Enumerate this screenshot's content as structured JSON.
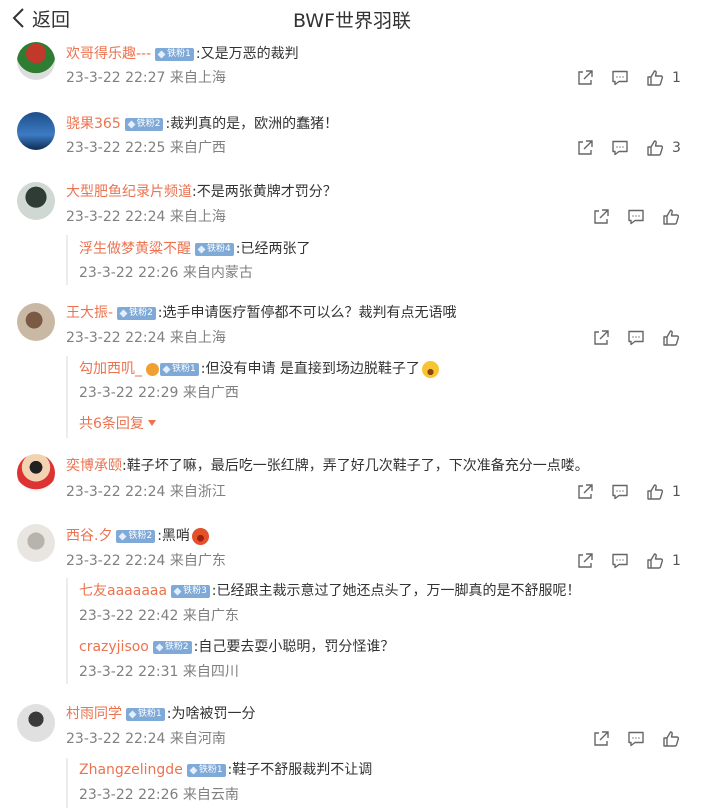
{
  "header": {
    "back_label": "返回",
    "title": "BWF世界羽联"
  },
  "comments": [
    {
      "user": "欢哥得乐趣---",
      "badge": "铁粉1",
      "text": ":又是万恶的裁判",
      "meta": "23-3-22 22:27 来自上海",
      "likes": "1"
    },
    {
      "user": "骁果365",
      "badge": "铁粉2",
      "text": ":裁判真的是，欧洲的蠢猪！",
      "meta": "23-3-22 22:25 来自广西",
      "likes": "3"
    },
    {
      "user": "大型肥鱼纪录片频道",
      "text": ":不是两张黄牌才罚分？",
      "meta": "23-3-22 22:24 来自上海",
      "replies": [
        {
          "user": "浮生做梦黄粱不醒",
          "badge": "铁粉4",
          "text": ":已经两张了",
          "meta": "23-3-22 22:26 来自内蒙古"
        }
      ]
    },
    {
      "user": "王大振-",
      "badge": "铁粉2",
      "text": ":选手申请医疗暂停都不可以么？裁判有点无语哦",
      "meta": "23-3-22 22:24 来自上海",
      "replies": [
        {
          "user": "勾加西叽_",
          "badge": "铁粉1",
          "text": ":但没有申请 是直接到场边脱鞋子了",
          "emoji": "laughing-emoji",
          "meta": "23-3-22 22:29 来自广西"
        }
      ],
      "more_replies": "共6条回复"
    },
    {
      "user": "奕博承颐",
      "text": ":鞋子坏了嘛，最后吃一张红牌，弄了好几次鞋子了，下次准备充分一点喽。",
      "meta": "23-3-22 22:24 来自浙江",
      "likes": "1"
    },
    {
      "user": "西谷.夕",
      "badge": "铁粉2",
      "text": ":黑哨",
      "emoji": "angry-emoji",
      "meta": "23-3-22 22:24 来自广东",
      "likes": "1",
      "replies": [
        {
          "user": "七友aaaaaaa",
          "badge": "铁粉3",
          "text": ":已经跟主裁示意过了她还点头了，万一脚真的是不舒服呢！",
          "meta": "23-3-22 22:42 来自广东"
        },
        {
          "user": "crazyjisoo",
          "badge": "铁粉2",
          "text": ":自己要去耍小聪明，罚分怪谁？",
          "meta": "23-3-22 22:31 来自四川"
        }
      ]
    },
    {
      "user": "村雨同学",
      "badge": "铁粉1",
      "text": ":为啥被罚一分",
      "meta": "23-3-22 22:24 来自河南",
      "replies": [
        {
          "user": "Zhangzelingde",
          "badge": "铁粉1",
          "text": ":鞋子不舒服裁判不让调",
          "meta": "23-3-22 22:26 来自云南"
        }
      ]
    }
  ],
  "icons": {
    "share": "share-icon",
    "comment": "comment-icon",
    "like": "thumbs-up-icon",
    "back": "chevron-left-icon"
  },
  "colors": {
    "username": "#eb7350",
    "meta": "#808080",
    "badge": "#7fa9d7",
    "icon": "#666666"
  }
}
